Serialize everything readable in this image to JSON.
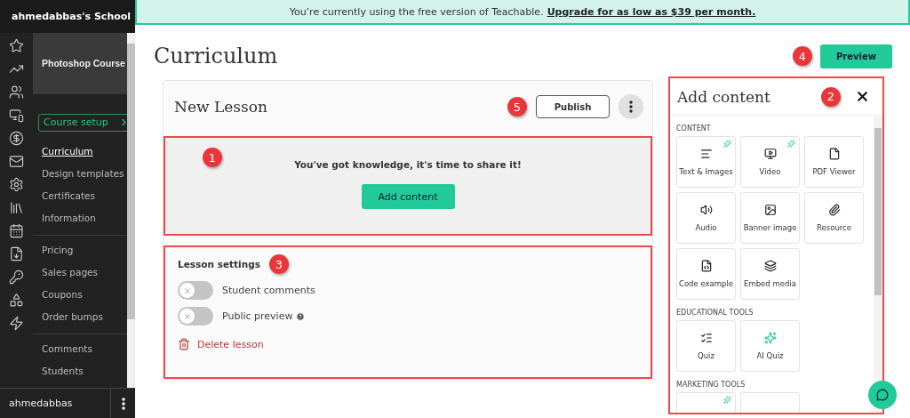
{
  "school": {
    "name": "ahmedabbas's School"
  },
  "course_nav": {
    "course_title": "Photoshop Course",
    "section_button": "Course setup",
    "groups": [
      [
        {
          "label": "Curriculum",
          "selected": true
        },
        {
          "label": "Design templates",
          "selected": false
        },
        {
          "label": "Certificates",
          "selected": false
        },
        {
          "label": "Information",
          "selected": false
        }
      ],
      [
        {
          "label": "Pricing",
          "selected": false
        },
        {
          "label": "Sales pages",
          "selected": false
        },
        {
          "label": "Coupons",
          "selected": false
        },
        {
          "label": "Order bumps",
          "selected": false
        }
      ],
      [
        {
          "label": "Comments",
          "selected": false
        },
        {
          "label": "Students",
          "selected": false
        }
      ]
    ]
  },
  "user": {
    "name": "ahmedabbas"
  },
  "banner": {
    "text": "You’re currently using the free version of Teachable.",
    "link": "Upgrade for as low as $39 per month."
  },
  "page_title": "Curriculum",
  "preview_button": {
    "label": "Preview",
    "callout": "4"
  },
  "lesson": {
    "title": "New Lesson",
    "publish": "Publish",
    "publish_callout": "5",
    "empty_state": {
      "callout": "1",
      "message": "You've got knowledge, it's time to share it!",
      "button": "Add content"
    },
    "settings": {
      "title": "Lesson settings",
      "callout": "3",
      "toggles": [
        {
          "label": "Student comments",
          "on": false,
          "help": false
        },
        {
          "label": "Public preview",
          "on": false,
          "help": true
        }
      ],
      "delete": "Delete lesson"
    }
  },
  "content_panel": {
    "title": "Add content",
    "callout": "2",
    "sections": [
      {
        "title": "CONTENT",
        "tiles": [
          {
            "label": "Text & Images",
            "sparkle": true
          },
          {
            "label": "Video",
            "sparkle": true
          },
          {
            "label": "PDF Viewer",
            "sparkle": false
          },
          {
            "label": "Audio",
            "sparkle": false
          },
          {
            "label": "Banner image",
            "sparkle": false
          },
          {
            "label": "Resource",
            "sparkle": false
          },
          {
            "label": "Code example",
            "sparkle": false
          },
          {
            "label": "Embed media",
            "sparkle": false
          }
        ]
      },
      {
        "title": "EDUCATIONAL TOOLS",
        "tiles": [
          {
            "label": "Quiz",
            "sparkle": false
          },
          {
            "label": "AI Quiz",
            "sparkle": false
          }
        ]
      },
      {
        "title": "MARKETING TOOLS",
        "tiles": [
          {
            "sparkle": true
          },
          {
            "sparkle": false
          }
        ]
      }
    ]
  }
}
